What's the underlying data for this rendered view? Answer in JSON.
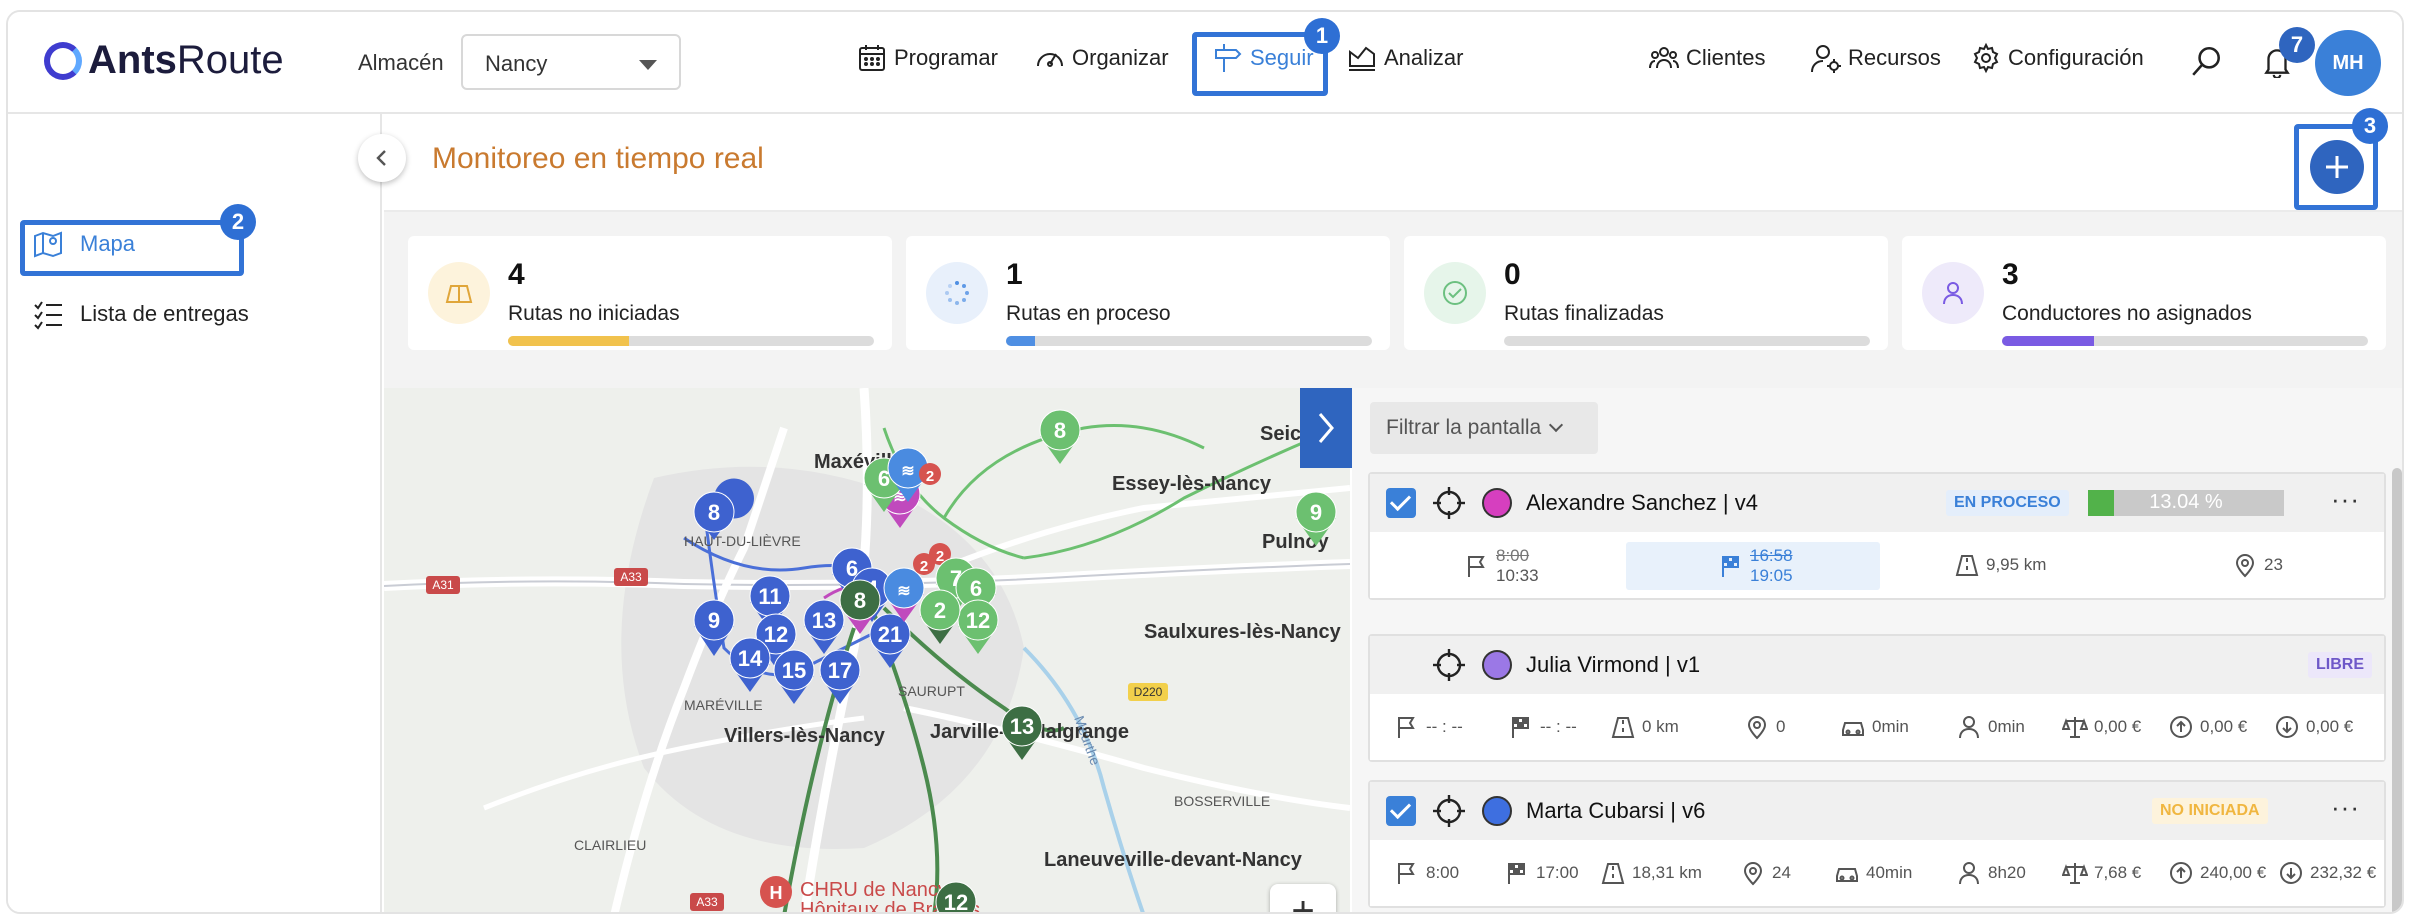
{
  "header": {
    "logo_bold": "Ants",
    "logo_light": "Route",
    "almacen_label": "Almacén",
    "almacen_value": "Nancy",
    "nav": {
      "programar": "Programar",
      "organizar": "Organizar",
      "seguir": "Seguir",
      "analizar": "Analizar",
      "clientes": "Clientes",
      "recursos": "Recursos",
      "configuracion": "Configuración"
    },
    "notifications_count": "7",
    "avatar_initials": "MH"
  },
  "tutorial_badges": [
    "1",
    "2",
    "3"
  ],
  "sidebar": {
    "items": [
      {
        "label": "Mapa"
      },
      {
        "label": "Lista de entregas"
      }
    ]
  },
  "page": {
    "title": "Monitoreo en tiempo real"
  },
  "stats": [
    {
      "value": "4",
      "label": "Rutas no iniciadas",
      "fraction": 0.33,
      "color": "#f1c24d"
    },
    {
      "value": "1",
      "label": "Rutas en proceso",
      "fraction": 0.08,
      "color": "#4f8fe3"
    },
    {
      "value": "0",
      "label": "Rutas finalizadas",
      "fraction": 0,
      "color": "#6cc080"
    },
    {
      "value": "3",
      "label": "Conductores no asignados",
      "fraction": 0.25,
      "color": "#7a5be3"
    }
  ],
  "map": {
    "places": [
      "Maxéville",
      "Essey-lès-Nancy",
      "Seic",
      "Pulnoy",
      "HAUT-DU-LIÈVRE",
      "Saulxures-lès-Nancy",
      "SAURUPT",
      "MARÉVILLE",
      "Villers-lès-Nancy",
      "Jarville-la-Malgrange",
      "BOSSERVILLE",
      "CLAIRLIEU",
      "Laneuveville-devant-Nancy",
      "CHRU de Nancy",
      "Hôpitaux de Brabois"
    ],
    "roads": [
      "A31",
      "A33",
      "D220",
      "A33",
      "Meurthe"
    ],
    "zoom_in": "+"
  },
  "panel": {
    "filter_label": "Filtrar la pantalla",
    "routes": [
      {
        "driver": "Alexandre Sanchez | v4",
        "dot_color": "#d63fbf",
        "status": "EN PROCESO",
        "status_color": "#3a80d8",
        "status_bg": "#e4eefb",
        "checked": true,
        "progress_text": "13.04 %",
        "progress_fraction": 0.1304,
        "start_planned": "8:00",
        "start_actual": "10:33",
        "end_planned": "16:58",
        "end_actual": "19:05",
        "distance": "9,95 km",
        "stops": "23"
      },
      {
        "driver": "Julia Virmond | v1",
        "dot_color": "#9b78e6",
        "status": "LIBRE",
        "status_color": "#6e58c8",
        "status_bg": "#ece7fa",
        "checked": false,
        "start": "-- : --",
        "end": "-- : --",
        "distance": "0 km",
        "stops": "0",
        "drive": "0min",
        "work": "0min",
        "cost": "0,00 €",
        "revenue": "0,00 €",
        "expense": "0,00 €"
      },
      {
        "driver": "Marta Cubarsi | v6",
        "dot_color": "#3e6fe0",
        "status": "NO INICIADA",
        "status_color": "#f0b640",
        "status_bg": "#fdf3dc",
        "checked": true,
        "start": "8:00",
        "end": "17:00",
        "distance": "18,31 km",
        "stops": "24",
        "drive": "40min",
        "work": "8h20",
        "cost": "7,68 €",
        "revenue": "240,00 €",
        "expense": "232,32 €"
      }
    ]
  }
}
